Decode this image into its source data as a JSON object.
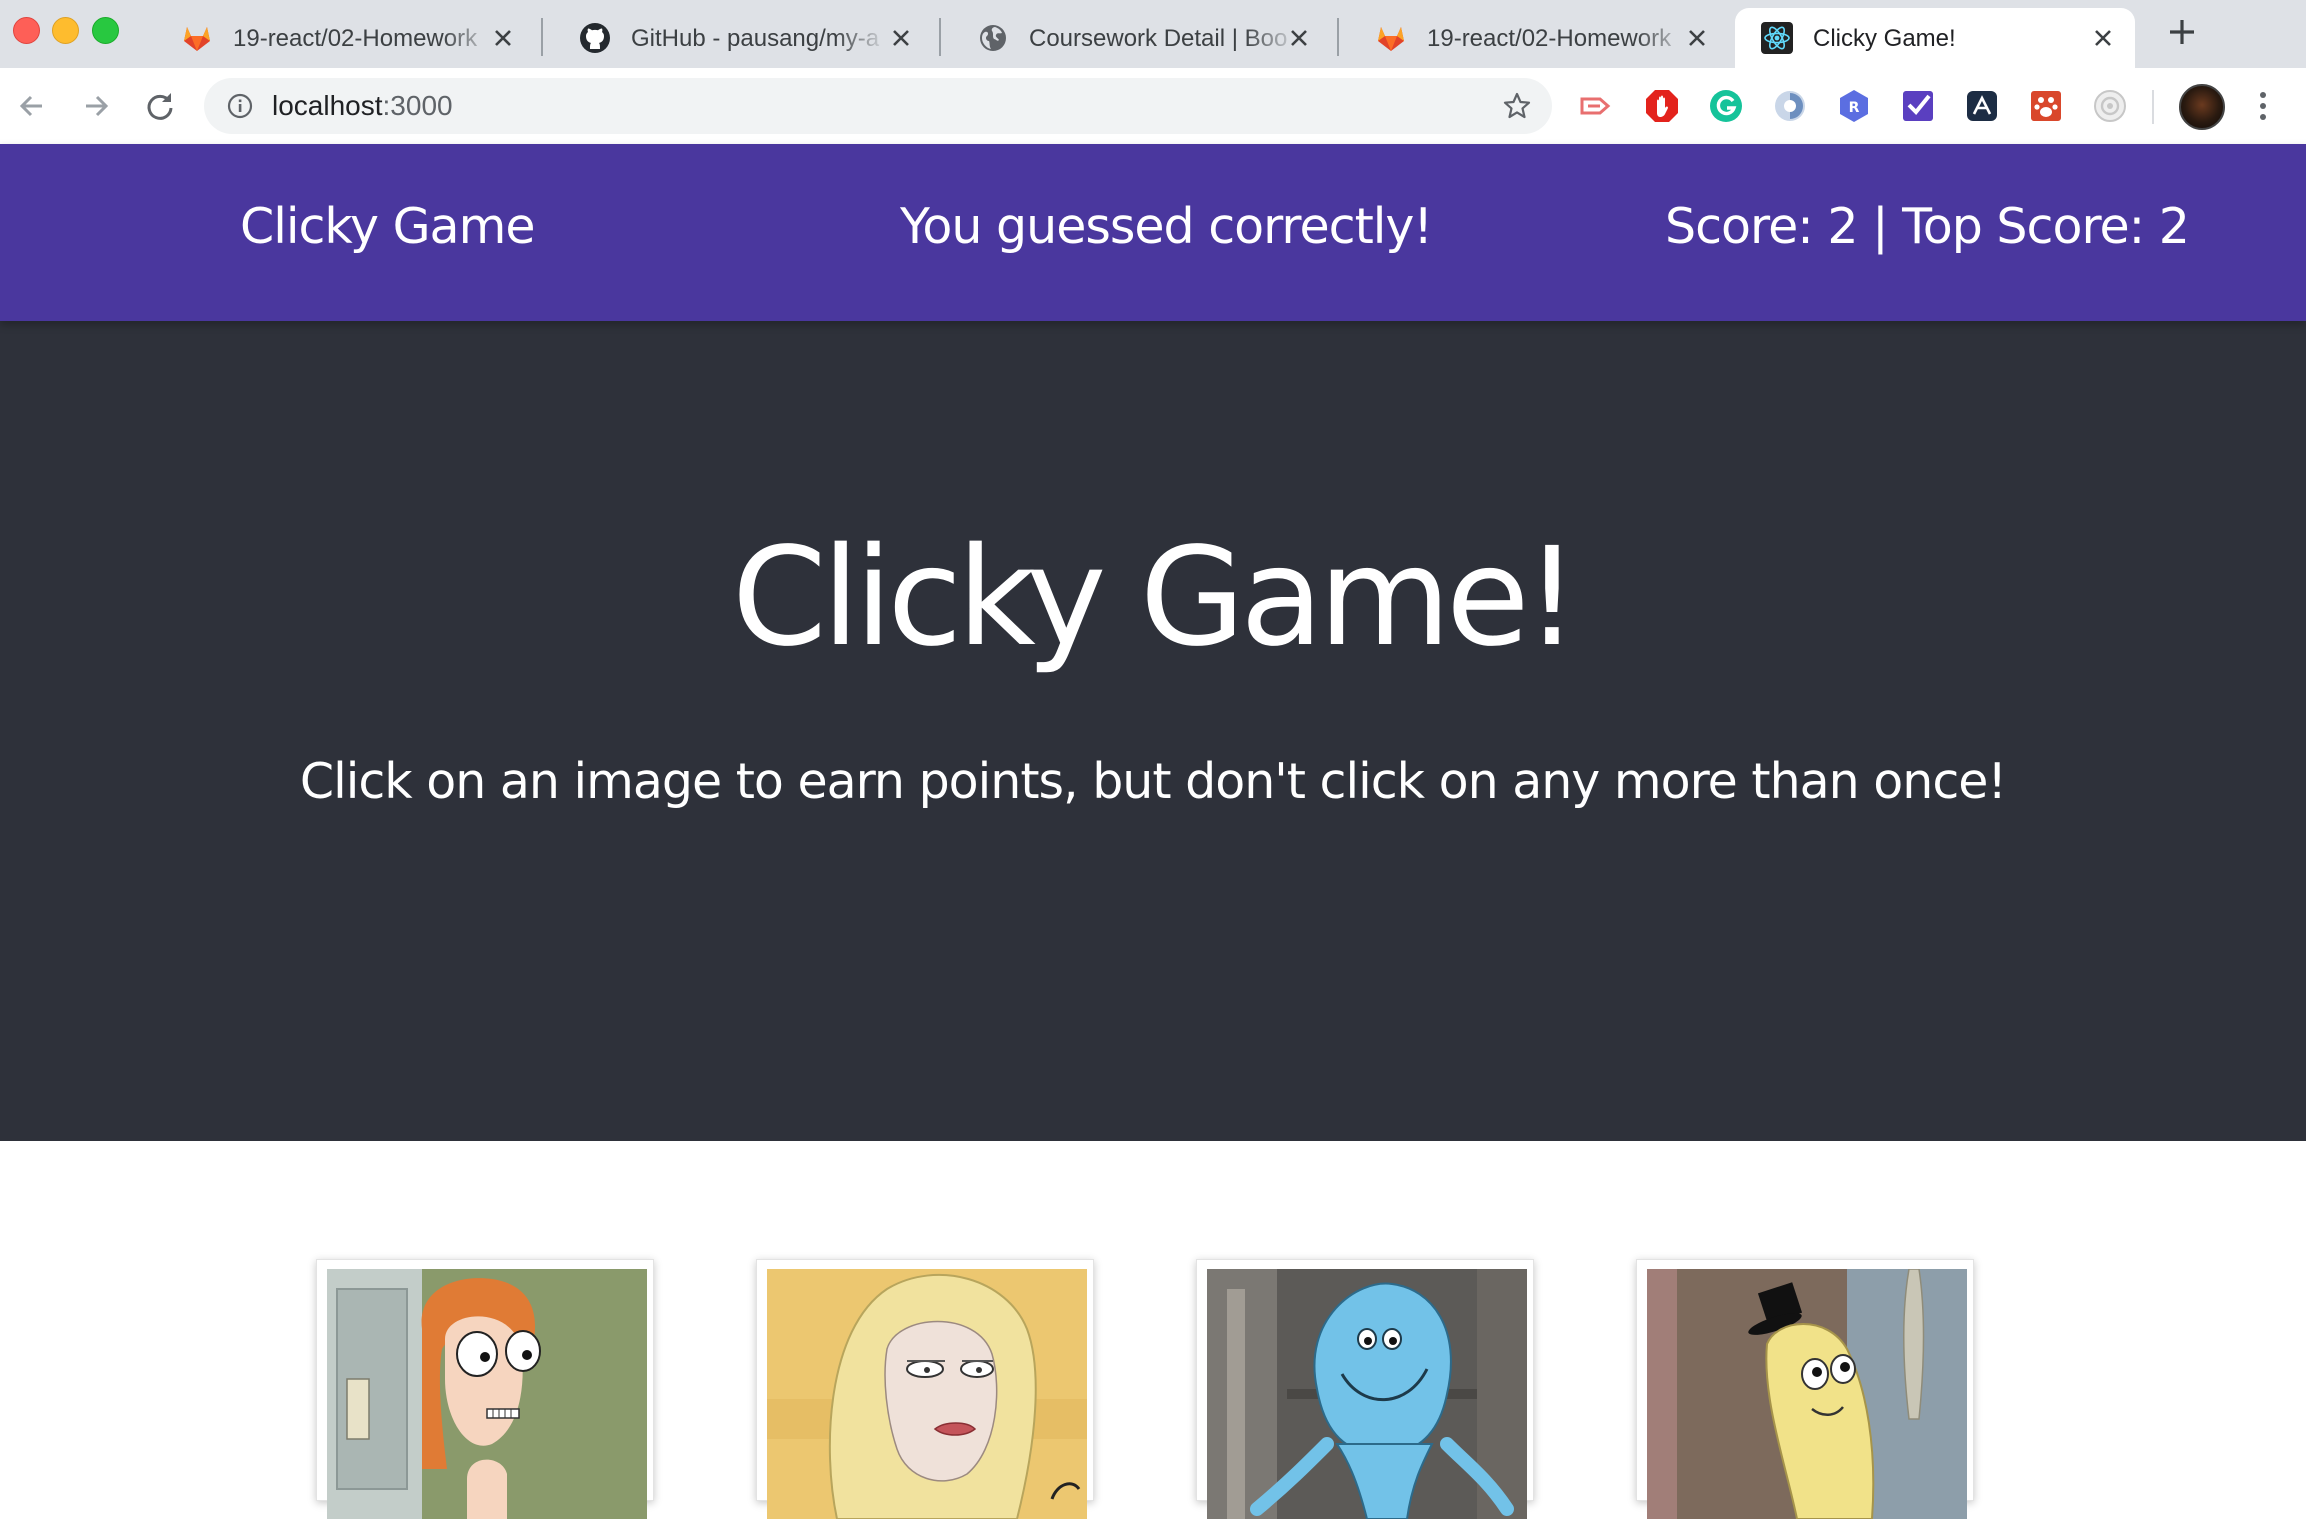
{
  "browser": {
    "tabs": [
      {
        "title": "19-react/02-Homework",
        "icon": "gitlab-icon",
        "active": false
      },
      {
        "title": "GitHub - pausang/my-a",
        "icon": "github-icon",
        "active": false
      },
      {
        "title": "Coursework Detail | Boo",
        "icon": "globe-icon",
        "active": false
      },
      {
        "title": "19-react/02-Homework",
        "icon": "gitlab-icon",
        "active": false
      },
      {
        "title": "Clicky Game!",
        "icon": "react-icon",
        "active": true
      }
    ],
    "address": {
      "host": "localhost",
      "port": ":3000"
    },
    "extensions": [
      "cast-icon",
      "adblock-icon",
      "grammarly-icon",
      "extension-icon",
      "r-extension-icon",
      "checkmark-extension-icon",
      "dashboard-extension-icon",
      "paw-extension-icon",
      "camera-extension-icon"
    ]
  },
  "navbar": {
    "brand": "Clicky Game",
    "message": "You guessed correctly!",
    "score_text": "Score: 2 | Top Score: 2",
    "score": 2,
    "top_score": 2,
    "background": "#4a379e"
  },
  "hero": {
    "title": "Clicky Game!",
    "subtitle": "Click on an image to earn points, but don't click on any more than once!",
    "background": "#2e313a"
  },
  "characters": [
    {
      "name": "summer-card"
    },
    {
      "name": "beth-card"
    },
    {
      "name": "mr-meeseeks-card"
    },
    {
      "name": "mr-poopybutthole-card"
    }
  ]
}
